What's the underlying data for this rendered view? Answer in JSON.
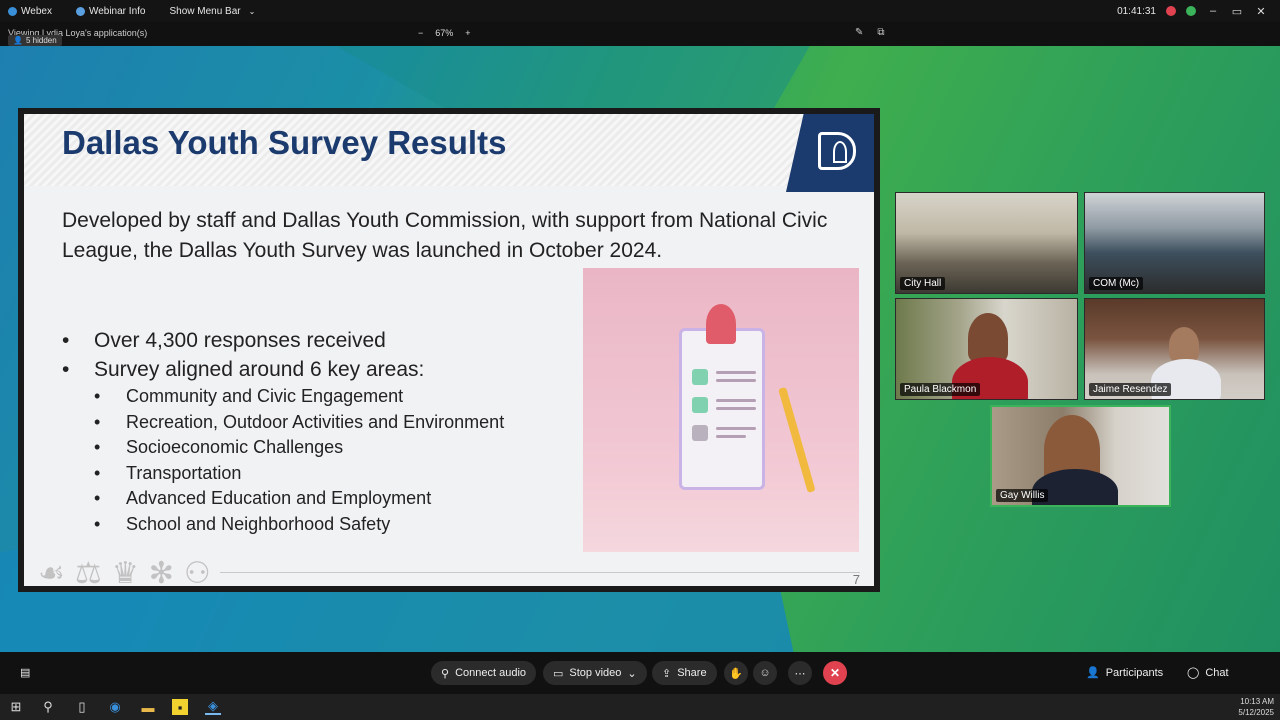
{
  "topbar": {
    "app_name": "Webex",
    "webinar_info": "Webinar Info",
    "show_menu_bar": "Show Menu Bar",
    "timer": "01:41:31"
  },
  "subbar": {
    "viewing": "Viewing Lydia Loya's application(s)",
    "hidden_count": "5 hidden",
    "zoom_out": "−",
    "zoom_level": "67%",
    "zoom_in": "+"
  },
  "slide": {
    "title": "Dallas Youth Survey Results",
    "intro": "Developed by staff and Dallas Youth Commission, with support from National Civic League, the Dallas Youth Survey was launched in October 2024.",
    "bullets": [
      "Over 4,300 responses received",
      "Survey aligned around 6 key areas:"
    ],
    "sub_bullets": [
      "Community and Civic Engagement",
      "Recreation, Outdoor Activities and Environment",
      "Socioeconomic Challenges",
      "Transportation",
      "Advanced Education and Employment",
      "School and Neighborhood Safety"
    ],
    "page_number": "7"
  },
  "participants": [
    {
      "name": "City Hall"
    },
    {
      "name": "COM (Mc)"
    },
    {
      "name": "Paula Blackmon"
    },
    {
      "name": "Jaime Resendez"
    },
    {
      "name": "Gay Willis"
    }
  ],
  "controls": {
    "connect_audio": "Connect audio",
    "stop_video": "Stop video",
    "share": "Share",
    "participants": "Participants",
    "chat": "Chat"
  },
  "taskbar": {
    "time": "10:13 AM",
    "date": "5/12/2025"
  },
  "colors": {
    "accent_red": "#e0434f",
    "slide_title": "#1b3a6e",
    "active_speaker": "#3bb35a"
  }
}
